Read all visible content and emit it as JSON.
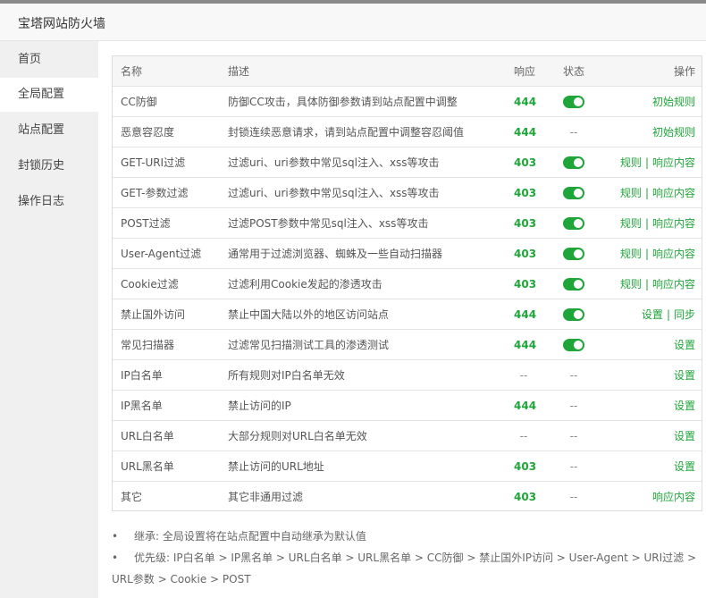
{
  "window": {
    "title": "宝塔网站防火墙"
  },
  "sidebar": {
    "items": [
      {
        "label": "首页",
        "active": false
      },
      {
        "label": "全局配置",
        "active": true
      },
      {
        "label": "站点配置",
        "active": false
      },
      {
        "label": "封锁历史",
        "active": false
      },
      {
        "label": "操作日志",
        "active": false
      }
    ]
  },
  "table": {
    "headers": {
      "name": "名称",
      "desc": "描述",
      "code": "响应",
      "status": "状态",
      "ops": "操作"
    },
    "rows": [
      {
        "name": "CC防御",
        "desc": "防御CC攻击，具体防御参数请到站点配置中调整",
        "code": "444",
        "status": "on",
        "ops": [
          "初始规则"
        ]
      },
      {
        "name": "恶意容忍度",
        "desc": "封锁连续恶意请求，请到站点配置中调整容忍阈值",
        "code": "444",
        "status": "--",
        "ops": [
          "初始规则"
        ]
      },
      {
        "name": "GET-URI过滤",
        "desc": "过滤uri、uri参数中常见sql注入、xss等攻击",
        "code": "403",
        "status": "on",
        "ops": [
          "规则",
          "响应内容"
        ]
      },
      {
        "name": "GET-参数过滤",
        "desc": "过滤uri、uri参数中常见sql注入、xss等攻击",
        "code": "403",
        "status": "on",
        "ops": [
          "规则",
          "响应内容"
        ]
      },
      {
        "name": "POST过滤",
        "desc": "过滤POST参数中常见sql注入、xss等攻击",
        "code": "403",
        "status": "on",
        "ops": [
          "规则",
          "响应内容"
        ]
      },
      {
        "name": "User-Agent过滤",
        "desc": "通常用于过滤浏览器、蜘蛛及一些自动扫描器",
        "code": "403",
        "status": "on",
        "ops": [
          "规则",
          "响应内容"
        ]
      },
      {
        "name": "Cookie过滤",
        "desc": "过滤利用Cookie发起的渗透攻击",
        "code": "403",
        "status": "on",
        "ops": [
          "规则",
          "响应内容"
        ]
      },
      {
        "name": "禁止国外访问",
        "desc": "禁止中国大陆以外的地区访问站点",
        "code": "444",
        "status": "on",
        "ops": [
          "设置",
          "同步"
        ]
      },
      {
        "name": "常见扫描器",
        "desc": "过滤常见扫描测试工具的渗透测试",
        "code": "444",
        "status": "on",
        "ops": [
          "设置"
        ]
      },
      {
        "name": "IP白名单",
        "desc": "所有规则对IP白名单无效",
        "code": "--",
        "status": "--",
        "ops": [
          "设置"
        ]
      },
      {
        "name": "IP黑名单",
        "desc": "禁止访问的IP",
        "code": "444",
        "status": "--",
        "ops": [
          "设置"
        ]
      },
      {
        "name": "URL白名单",
        "desc": "大部分规则对URL白名单无效",
        "code": "--",
        "status": "--",
        "ops": [
          "设置"
        ]
      },
      {
        "name": "URL黑名单",
        "desc": "禁止访问的URL地址",
        "code": "403",
        "status": "--",
        "ops": [
          "设置"
        ]
      },
      {
        "name": "其它",
        "desc": "其它非通用过滤",
        "code": "403",
        "status": "--",
        "ops": [
          "响应内容"
        ]
      }
    ]
  },
  "notes": {
    "bullet": "•",
    "inherit": "继承: 全局设置将在站点配置中自动继承为默认值",
    "priority_line1": "优先级: IP白名单 > IP黑名单 > URL白名单 > URL黑名单 > CC防御 > 禁止国外IP访问 > User-Agent > URI过滤 >",
    "priority_line2": "URL参数 > Cookie > POST"
  },
  "colors": {
    "accent": "#20a53a",
    "sidebar_bg": "#f0f0f0",
    "header_bg": "#f6f6f6"
  }
}
